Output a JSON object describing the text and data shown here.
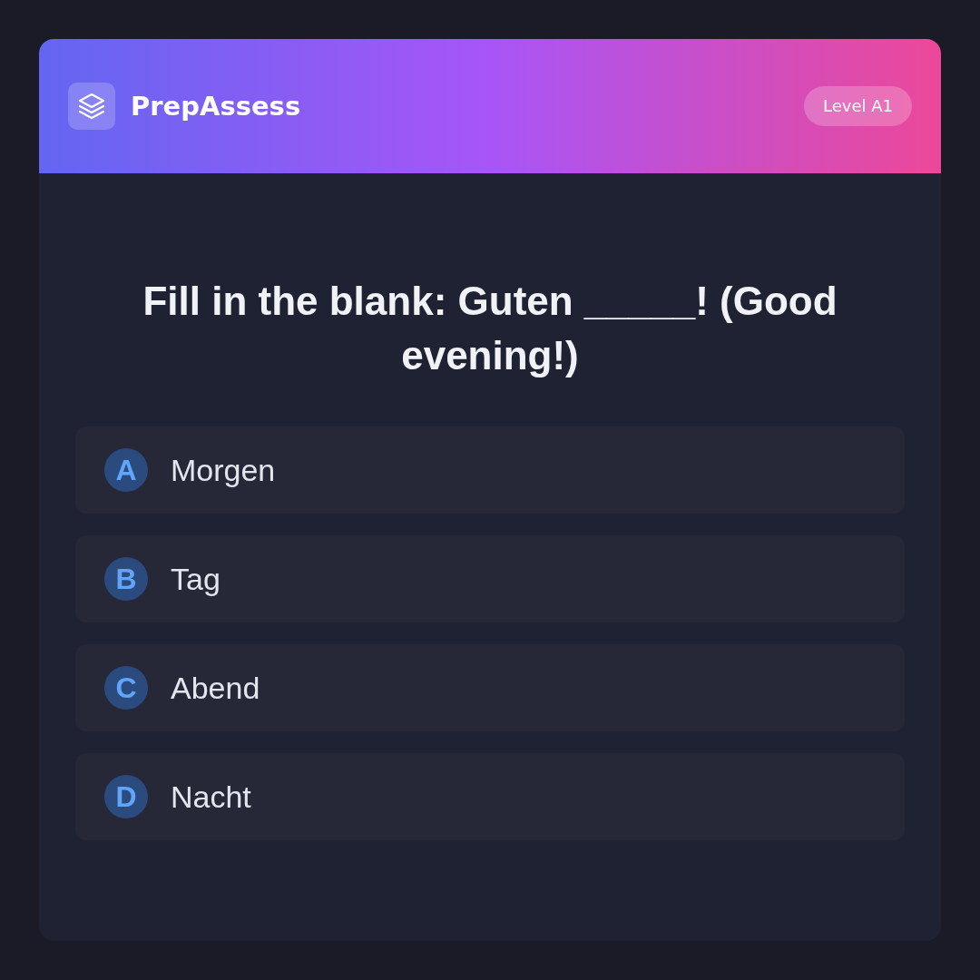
{
  "header": {
    "title": "PrepAssess",
    "badge": "Level A1"
  },
  "question": {
    "prompt": "Fill in the blank: Guten _____! (Good evening!)"
  },
  "options": [
    {
      "letter": "A",
      "label": "Morgen",
      "selected": false
    },
    {
      "letter": "B",
      "label": "Tag",
      "selected": false
    },
    {
      "letter": "C",
      "label": "Abend",
      "selected": false
    },
    {
      "letter": "D",
      "label": "Nacht",
      "selected": false
    }
  ]
}
